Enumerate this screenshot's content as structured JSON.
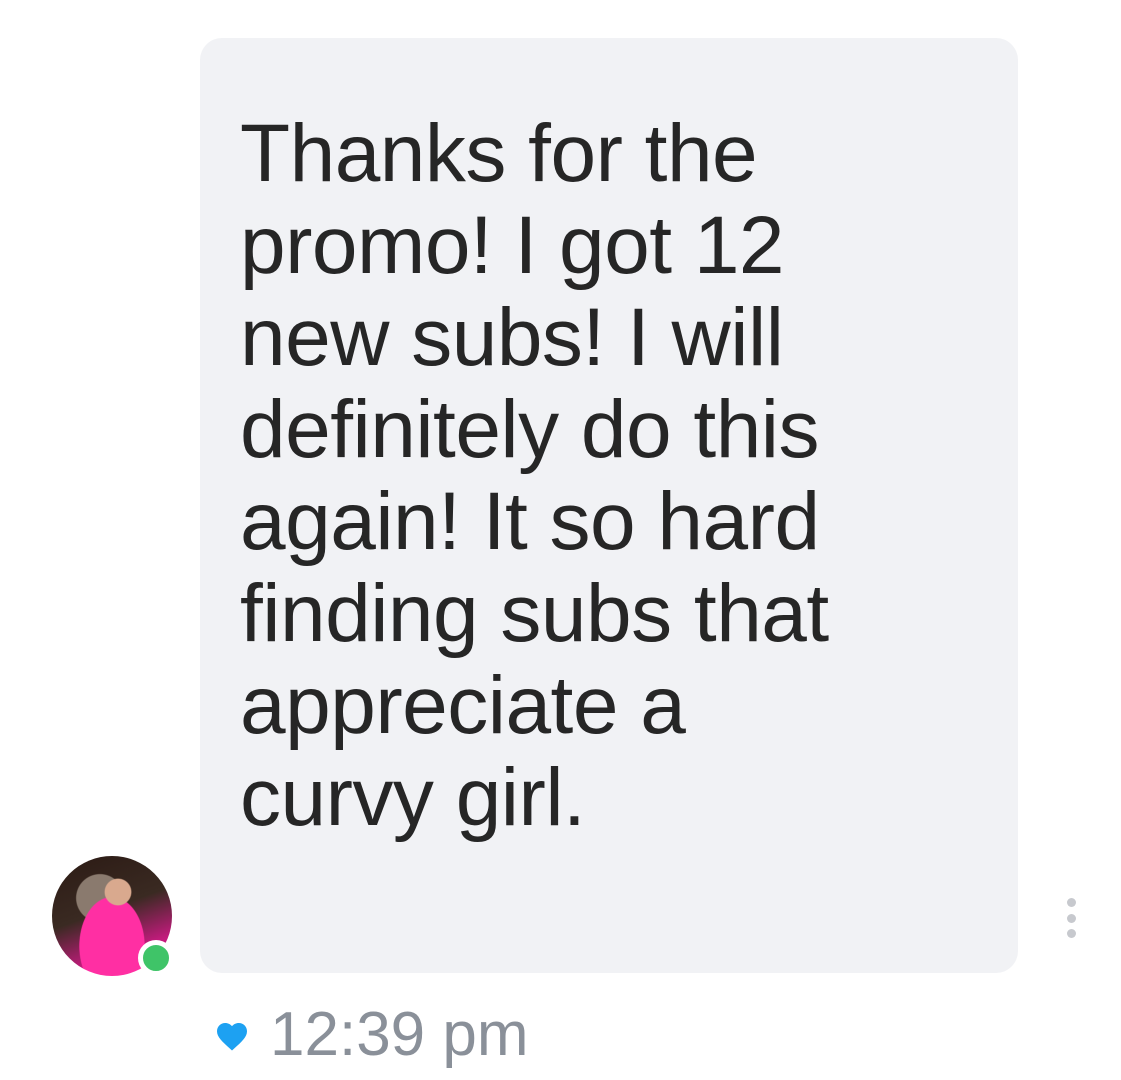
{
  "message": {
    "lines": [
      "Thanks for the",
      "promo! I got 12",
      "new subs! I will",
      "definitely do this",
      "again! It so hard",
      "finding subs that",
      "appreciate a",
      "curvy girl."
    ],
    "timestamp": "12:39 pm",
    "liked": true,
    "sender_online": true
  },
  "icons": {
    "like": "heart-icon",
    "options": "more-vertical-icon",
    "status": "online-dot"
  },
  "colors": {
    "bubble": "#f1f2f5",
    "text": "#262626",
    "heart": "#1da1f2",
    "online": "#3fc468",
    "timestamp": "#8a9099"
  }
}
